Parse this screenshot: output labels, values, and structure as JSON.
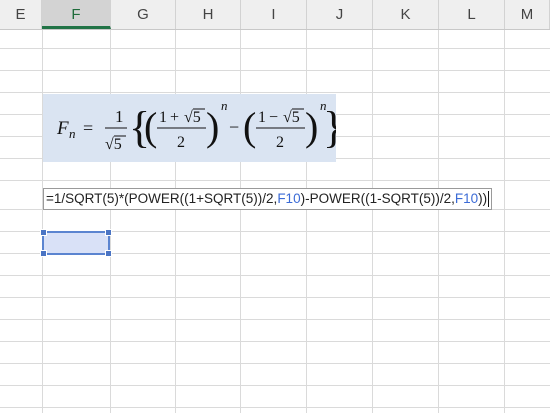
{
  "columns": [
    "E",
    "F",
    "G",
    "H",
    "I",
    "J",
    "K",
    "L",
    "M"
  ],
  "selected_column": "F",
  "formula_image": {
    "lhs": "F",
    "lhs_sub": "n",
    "equals": "=",
    "frac_num": "1",
    "sqrt_five": "√5",
    "one": "1",
    "plus": "+",
    "minus": "−",
    "two": "2",
    "exponent": "n",
    "lbrace": "{",
    "rbrace": "}",
    "lparen": "(",
    "rparen": ")"
  },
  "cell_edit": {
    "p1": "=1/SQRT(5)*(POWER",
    "p2": "((1+SQRT(5))/2,",
    "ref1": "F10",
    "p3": ")-POWER",
    "p4": "((1-SQRT(5))/2,",
    "ref2": "F10",
    "p5": "))"
  },
  "colors": {
    "ref_blue": "#3b6bd6",
    "formula_bg": "#dae4f2",
    "active_fill": "#d9e1f7",
    "selection_border": "#5b84d0"
  }
}
